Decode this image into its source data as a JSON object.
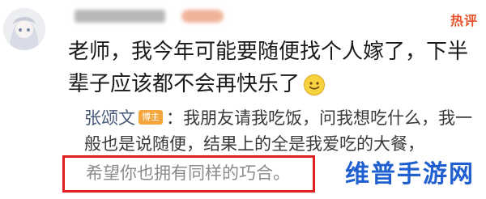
{
  "header": {
    "hot_label": "热评"
  },
  "comment": {
    "text": "老师，我今年可能要随便找个人嫁了，下半辈子应该都不会再快乐了",
    "emoji": "smile-emoji-icon"
  },
  "reply": {
    "author": "张颂文",
    "author_badge": "博主",
    "colon": "：",
    "text": "我朋友请我吃饭，问我想吃什么，我一般也是说随便，结果上的全是我爱吃的大餐，",
    "highlighted_text": "希望你也拥有同样的巧合。"
  },
  "colors": {
    "hot": "#e8522c",
    "highlight_border": "#e02020",
    "watermark": "#1f5fd0",
    "author": "#4a5b7a"
  },
  "watermark": "维普手游网"
}
